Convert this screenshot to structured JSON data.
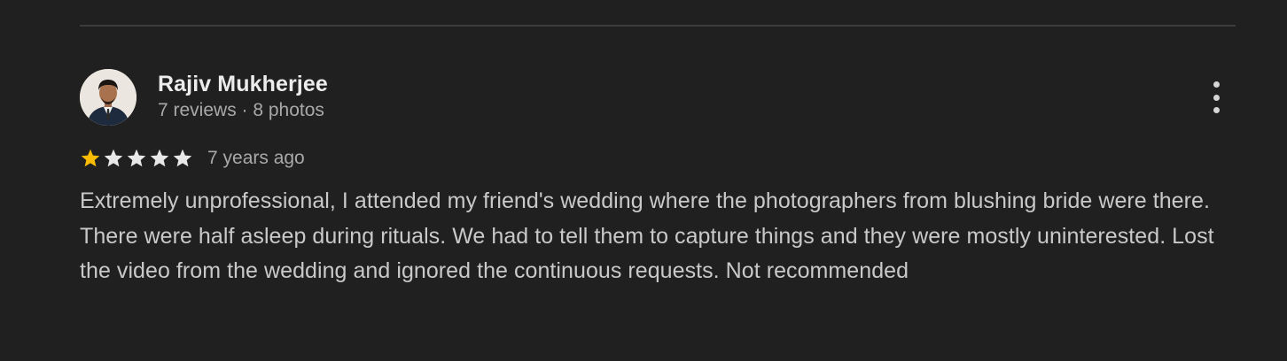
{
  "review": {
    "author_name": "Rajiv Mukherjee",
    "author_meta": "7 reviews · 8 photos",
    "rating": 1,
    "max_rating": 5,
    "date": "7 years ago",
    "text": "Extremely unprofessional, I attended my friend's wedding where the photographers from blushing bride were there. There were half asleep during rituals. We had to tell them to capture things and they were mostly uninterested. Lost the video from the wedding and ignored the continuous requests. Not recommended",
    "more_icon": "more-vert-icon"
  },
  "colors": {
    "background": "#202020",
    "star_filled": "#fbbc04",
    "star_empty": "#e8e8e8",
    "primary_text": "#ececec",
    "secondary_text": "#a9a9a9",
    "body_text": "#c9c9c9"
  }
}
